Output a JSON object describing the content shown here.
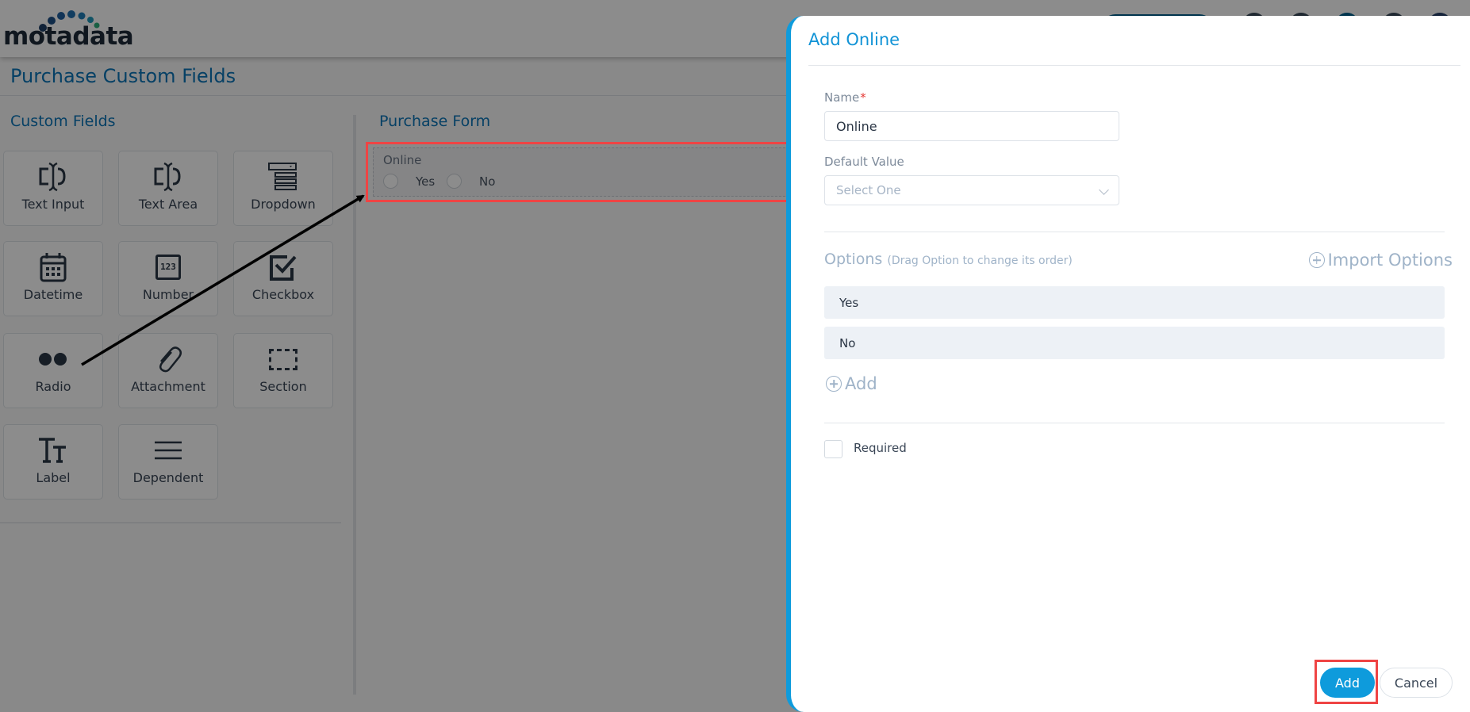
{
  "app": {
    "logo_text": "motadata",
    "page_title": "Purchase Custom Fields"
  },
  "custom_fields": {
    "title": "Custom Fields",
    "tiles": [
      {
        "label": "Text Input",
        "icon": "text-input-icon"
      },
      {
        "label": "Text Area",
        "icon": "text-area-icon"
      },
      {
        "label": "Dropdown",
        "icon": "dropdown-icon"
      },
      {
        "label": "Datetime",
        "icon": "calendar-icon"
      },
      {
        "label": "Number",
        "icon": "number-icon",
        "icon_text": "123"
      },
      {
        "label": "Checkbox",
        "icon": "checkbox-icon"
      },
      {
        "label": "Radio",
        "icon": "radio-icon"
      },
      {
        "label": "Attachment",
        "icon": "paperclip-icon"
      },
      {
        "label": "Section",
        "icon": "section-icon"
      },
      {
        "label": "Label",
        "icon": "label-icon",
        "icon_text": "Tт"
      },
      {
        "label": "Dependent",
        "icon": "dependent-icon"
      }
    ]
  },
  "purchase_form": {
    "title": "Purchase Form",
    "field": {
      "label": "Online",
      "options": [
        "Yes",
        "No"
      ]
    }
  },
  "dialog": {
    "title": "Add Online",
    "name_label": "Name",
    "required_marker": "*",
    "name_value": "Online",
    "default_value_label": "Default Value",
    "default_value_placeholder": "Select One",
    "options_title": "Options",
    "options_hint": "(Drag Option to change its order)",
    "import_options_label": "Import Options",
    "options": [
      "Yes",
      "No"
    ],
    "add_option_label": "Add",
    "required_label": "Required",
    "required_checked": false,
    "add_button": "Add",
    "cancel_button": "Cancel"
  },
  "colors": {
    "accent": "#0e9bdc",
    "title_blue": "#0b76b8",
    "highlight_red": "#ef4444"
  }
}
